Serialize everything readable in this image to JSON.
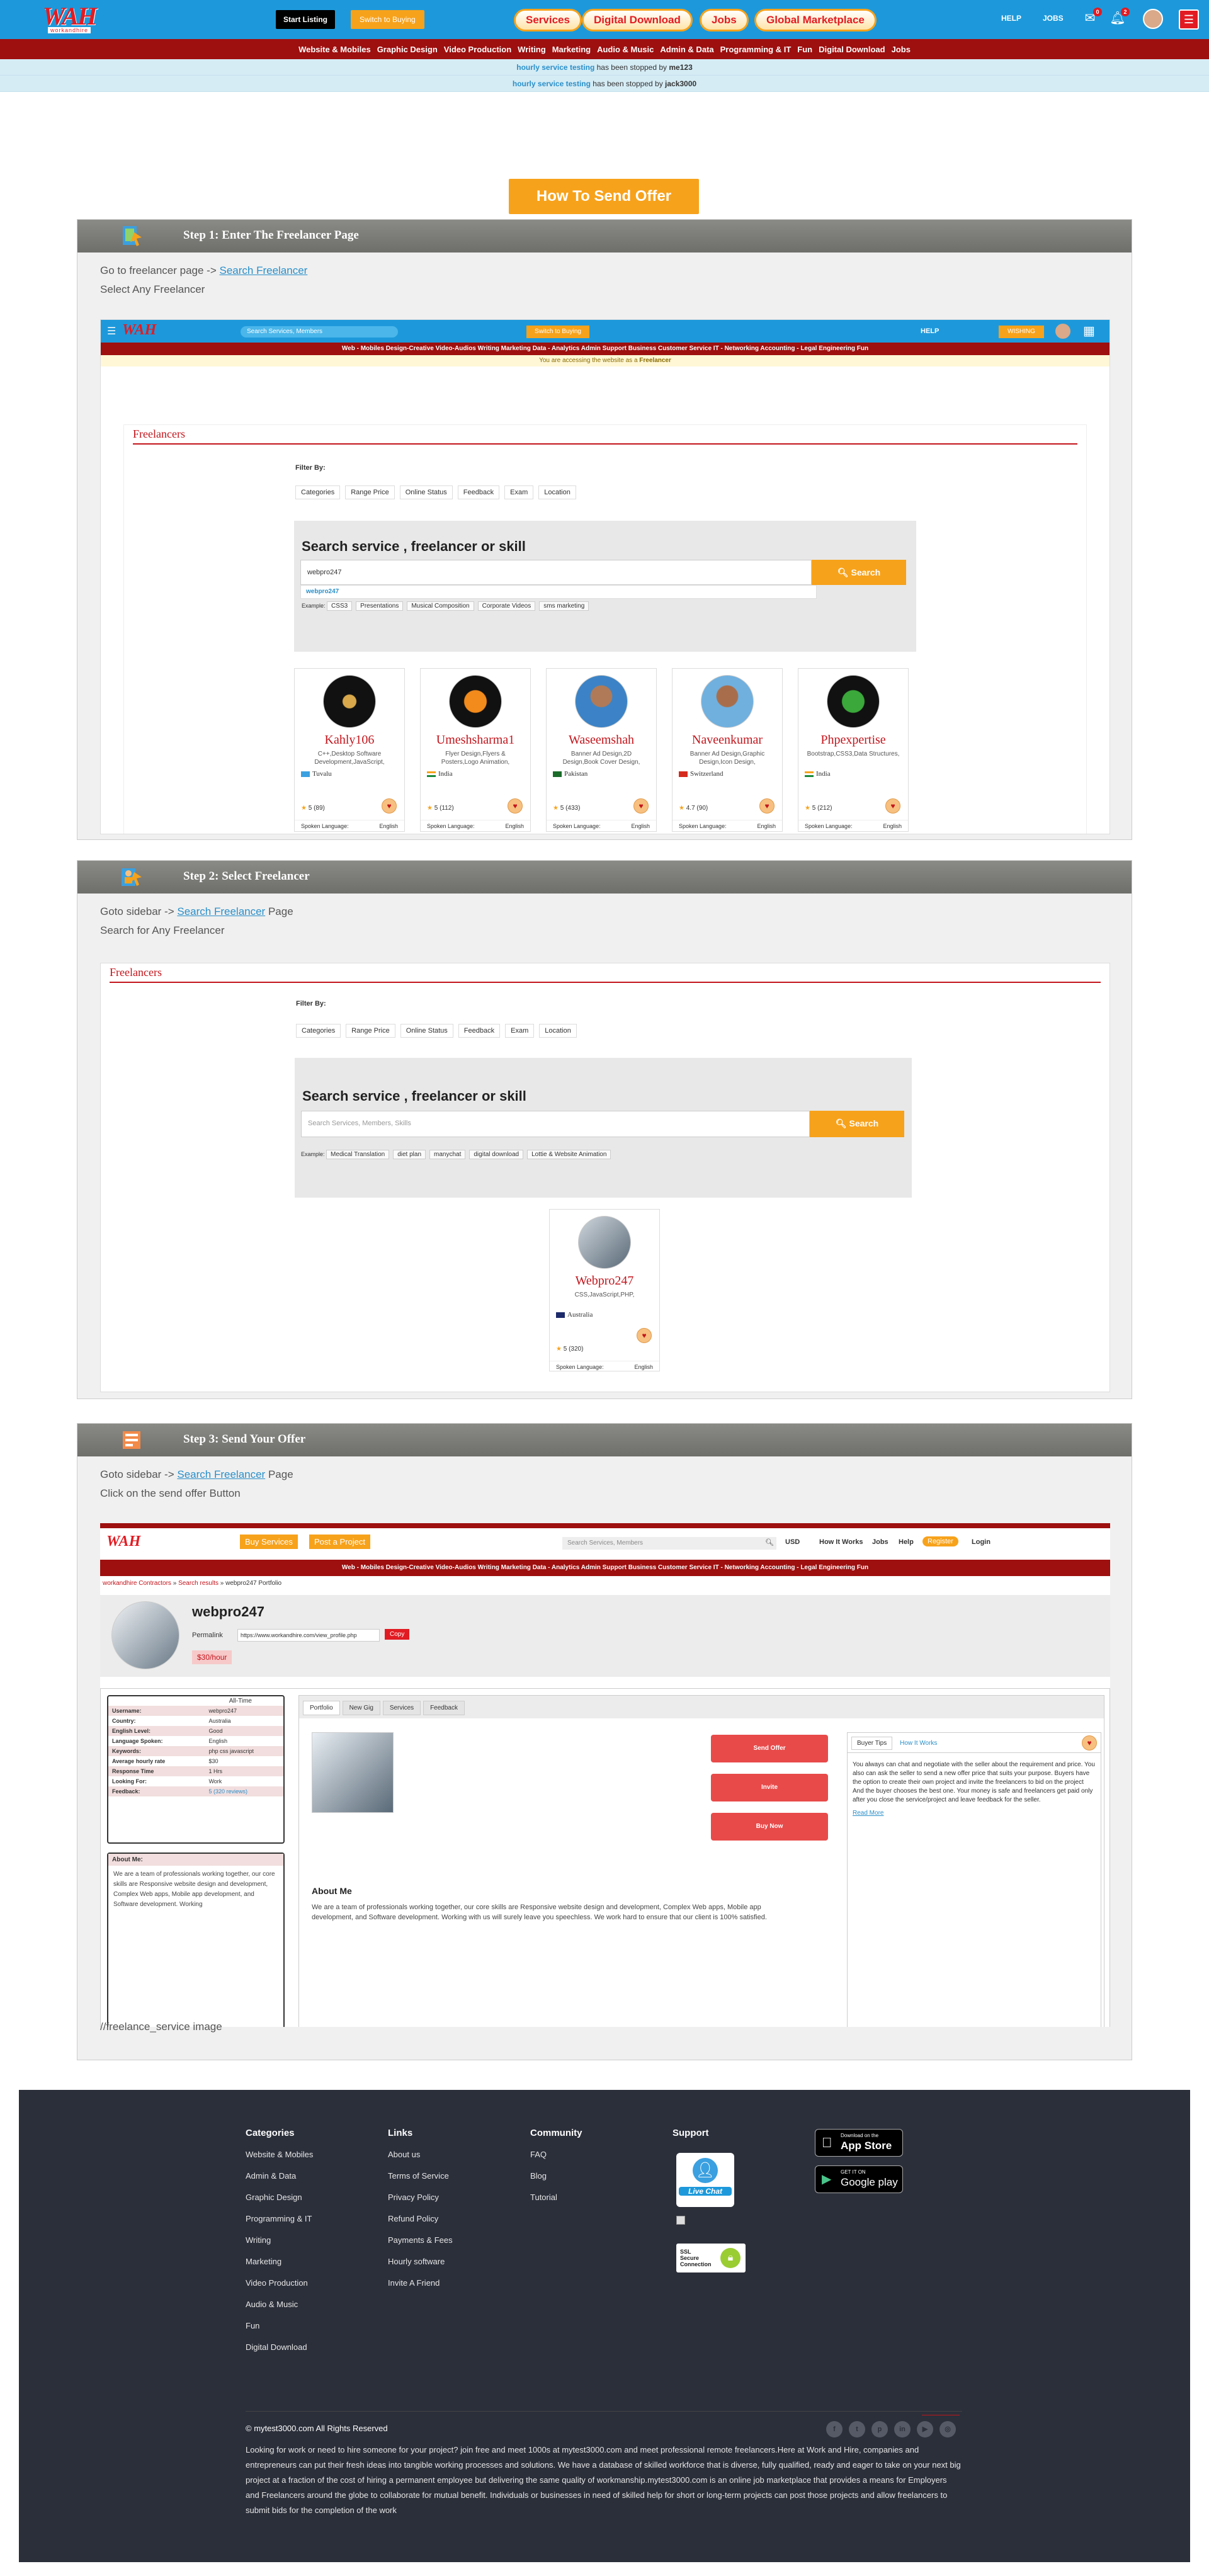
{
  "header": {
    "logo_text": "WAH",
    "logo_sub": "workandhire",
    "start_listing": "Start Listing",
    "switch_buying": "Switch to Buying",
    "pills": [
      "Services",
      "Digital Download",
      "Jobs",
      "Global Marketplace"
    ],
    "help": "HELP",
    "jobs": "JOBS",
    "msg_count": "0",
    "notif_count": "2"
  },
  "categories": [
    "Website & Mobiles",
    "Graphic Design",
    "Video Production",
    "Writing",
    "Marketing",
    "Audio & Music",
    "Admin & Data",
    "Programming & IT",
    "Fun",
    "Digital Download",
    "Jobs"
  ],
  "notices": [
    {
      "link": "hourly service testing",
      "text": " has been stopped by ",
      "user": "me123"
    },
    {
      "link": "hourly service testing",
      "text": " has been stopped by ",
      "user": "jack3000"
    }
  ],
  "how_to_title": "How To Send Offer",
  "step1": {
    "title": "Step 1: Enter The Freelancer Page",
    "line1_prefix": "Go to freelancer page -> ",
    "line1_link": "Search Freelancer",
    "line2": "Select Any Freelancer",
    "shot": {
      "search_placeholder": "Search Services, Members",
      "switch": "Switch to Buying",
      "help": "HELP",
      "wishes": "WISHING",
      "cats": "Web - Mobiles   Design-Creative   Video-Audios   Writing   Marketing   Data - Analytics   Admin Support   Business   Customer Service   IT - Networking   Accounting - Legal   Engineering   Fun",
      "notice_prefix": "You are accessing the website as a ",
      "notice_role": "Freelancer",
      "panel_title": "Freelancers",
      "filter_by": "Filter By:",
      "filters": [
        "Categories",
        "Range Price",
        "Online Status",
        "Feedback",
        "Exam",
        "Location"
      ],
      "search_title": "Search service , freelancer or skill",
      "input_value": "webpro247",
      "suggestion": "webpro247",
      "search_btn": "Search",
      "chips_label": "Example:",
      "chips": [
        "CSS3",
        "Presentations",
        "Musical Composition",
        "Corporate Videos",
        "sms marketing"
      ],
      "cards": [
        {
          "name": "Kahly106",
          "desc": "C++,Desktop Software Development,JavaScript,",
          "country": "Tuvalu",
          "rating": "5 (89)",
          "lang_label": "Spoken Language:",
          "lang": "English"
        },
        {
          "name": "Umeshsharma1",
          "desc": "Flyer Design,Flyers & Posters,Logo Animation,",
          "country": "India",
          "rating": "5 (112)",
          "lang_label": "Spoken Language:",
          "lang": "English"
        },
        {
          "name": "Waseemshah",
          "desc": "Banner Ad Design,2D Design,Book Cover Design,",
          "country": "Pakistan",
          "rating": "5 (433)",
          "lang_label": "Spoken Language:",
          "lang": "English"
        },
        {
          "name": "Naveenkumar",
          "desc": "Banner Ad Design,Graphic Design,Icon Design,",
          "country": "Switzerland",
          "rating": "4.7 (90)",
          "lang_label": "Spoken Language:",
          "lang": "English"
        },
        {
          "name": "Phpexpertise",
          "desc": "Bootstrap,CSS3,Data Structures,",
          "country": "India",
          "rating": "5 (212)",
          "lang_label": "Spoken Language:",
          "lang": "English"
        }
      ]
    }
  },
  "step2": {
    "title": "Step 2: Select Freelancer",
    "line1_prefix": "Goto sidebar -> ",
    "line1_link": "Search Freelancer",
    "line1_suffix": " Page",
    "line2": "Search for Any Freelancer",
    "shot": {
      "panel_title": "Freelancers",
      "filter_by": "Filter By:",
      "filters": [
        "Categories",
        "Range Price",
        "Online Status",
        "Feedback",
        "Exam",
        "Location"
      ],
      "search_title": "Search service , freelancer or skill",
      "placeholder": "Search Services, Members, Skills",
      "search_btn": "Search",
      "chips_label": "Example:",
      "chips": [
        "Medical Translation",
        "diet plan",
        "manychat",
        "digital download",
        "Lottie & Website Animation"
      ],
      "card": {
        "name": "Webpro247",
        "desc": "CSS,JavaScript,PHP,",
        "country": "Australia",
        "rating": "5 (320)",
        "lang_label": "Spoken Language:",
        "lang": "English"
      }
    }
  },
  "step3": {
    "title": "Step 3: Send Your Offer",
    "line1_prefix": "Goto sidebar -> ",
    "line1_link": "Search Freelancer",
    "line1_suffix": " Page",
    "line2": "Click on the send offer Button",
    "caption": "//freelance_service image",
    "shot": {
      "buy_services": "Buy Services",
      "post_project": "Post a Project",
      "search_placeholder": "Search Services, Members",
      "currency": "USD",
      "nav": [
        "How It Works",
        "Jobs",
        "Help"
      ],
      "register": "Register",
      "login": "Login",
      "cats": "Web - Mobiles   Design-Creative   Video-Audios   Writing   Marketing   Data - Analytics   Admin Support   Business   Customer Service   IT - Networking   Accounting - Legal   Engineering   Fun",
      "breadcrumb": [
        "workandhire Contractors",
        "Search results",
        "webpro247 Portfolio"
      ],
      "username": "webpro247",
      "permalink_label": "Permalink",
      "permalink_value": "https://www.workandhire.com/view_profile.php",
      "copy": "Copy",
      "rate": "$30/hour",
      "all_time": "All-Time",
      "info": [
        {
          "k": "Username:",
          "v": "webpro247"
        },
        {
          "k": "Country:",
          "v": "Australia"
        },
        {
          "k": "English Level:",
          "v": "Good"
        },
        {
          "k": "Language Spoken:",
          "v": "English"
        },
        {
          "k": "Keywords:",
          "v": "php css javascript"
        },
        {
          "k": "Average hourly rate",
          "v": "$30"
        },
        {
          "k": "Response Time",
          "v": "1 Hrs"
        },
        {
          "k": "Looking For:",
          "v": "Work"
        },
        {
          "k": "Feedback:",
          "v": "5 (320 reviews)"
        }
      ],
      "about_head": "About Me:",
      "about_short": "We are a team of professionals working together, our core skills are Responsive website design and development, Complex Web apps, Mobile app development, and Software development. Working",
      "tabs": [
        "Portfolio",
        "New Gig",
        "Services",
        "Feedback"
      ],
      "send_offer": "Send Offer",
      "invite": "Invite",
      "buy_now": "Buy Now",
      "buyer_tabs": [
        "Buyer Tips",
        "How It Works"
      ],
      "tips": "You always can chat and negotiate with the seller about the requirement and price. You also can ask the seller to send a new offer price that suits your purpose. Buyers have the option to create their own project and invite the freelancers to bid on the project And the buyer chooses the best one. Your money is safe and freelancers get paid only after you close the service/project and leave feedback for the seller.",
      "read_more": "Read More",
      "about_title": "About Me",
      "about_text": "We are a team of professionals working together, our core skills are Responsive website design and development, Complex Web apps, Mobile app development, and Software development. Working with us will surely leave you speechless. We work hard to ensure that our client is 100% satisfied."
    }
  },
  "footer": {
    "categories_title": "Categories",
    "categories": [
      "Website & Mobiles",
      "Admin & Data",
      "Graphic Design",
      "Programming & IT",
      "Writing",
      "Marketing",
      "Video Production",
      "Audio & Music",
      "Fun",
      "Digital Download"
    ],
    "links_title": "Links",
    "links": [
      "About us",
      "Terms of Service",
      "Privacy Policy",
      "Refund Policy",
      "Payments & Fees",
      "Hourly software",
      "Invite A Friend"
    ],
    "community_title": "Community",
    "community": [
      "FAQ",
      "Blog",
      "Tutorial"
    ],
    "support_title": "Support",
    "live_chat": "Live Chat",
    "ssl_line1": "SSL",
    "ssl_line2": "Secure",
    "ssl_line3": "Connection",
    "appstore_small": "Download on the",
    "appstore_big": "App Store",
    "gplay_small": "GET IT ON",
    "gplay_big": "Google play",
    "copyright": "© mytest3000.com All Rights Reserved",
    "about": "Looking for work or need to hire someone for your project? join free and meet 1000s at mytest3000.com and meet professional remote freelancers.Here at Work and Hire, companies and entrepreneurs can put their fresh ideas into tangible working processes and solutions. We have a database of skilled workforce that is diverse, fully qualified, ready and eager to take on your next big project at a fraction of the cost of hiring a permanent employee but delivering the same quality of workmanship.mytest3000.com is an online job marketplace that provides a means for Employers and Freelancers around the globe to collaborate for mutual benefit. Individuals or businesses in need of skilled help for short or long-term projects can post those projects and allow freelancers to submit bids for the completion of the work"
  },
  "colors": {
    "brand_blue": "#1d99db",
    "brand_red": "#9e0f0f",
    "accent": "#f7a21b"
  }
}
